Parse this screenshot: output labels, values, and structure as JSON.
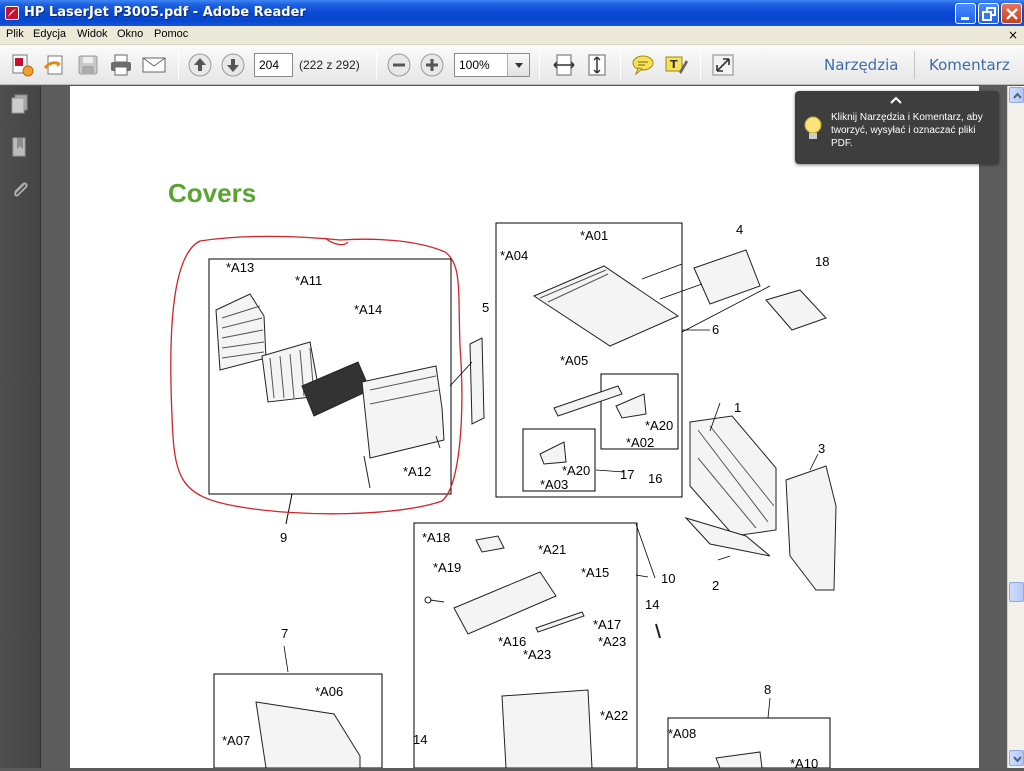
{
  "window": {
    "title": "HP LaserJet P3005.pdf - Adobe Reader"
  },
  "menu": {
    "items": [
      "Plik",
      "Edycja",
      "Widok",
      "Okno",
      "Pomoc"
    ],
    "close_glyph": "×"
  },
  "toolbar": {
    "page_number": "204",
    "page_count": "(222 z 292)",
    "zoom": "100%",
    "tools_label": "Narzędzia",
    "comment_label": "Komentarz"
  },
  "tooltip": {
    "text": "Kliknij Narzędzia i Komentarz, aby tworzyć, wysyłać i oznaczać pliki PDF."
  },
  "document": {
    "heading": "Covers",
    "heading_color": "#5aa432",
    "labels": {
      "a13": "*A13",
      "a11": "*A11",
      "a14": "*A14",
      "a12": "*A12",
      "n9": "9",
      "n5": "5",
      "a01": "*A01",
      "a04": "*A04",
      "a05": "*A05",
      "a02": "*A02",
      "a20a": "*A20",
      "a20b": "*A20",
      "a03": "*A03",
      "n17": "17",
      "n16": "16",
      "n6": "6",
      "n4": "4",
      "n18": "18",
      "n1": "1",
      "n3": "3",
      "n2": "2",
      "a18": "*A18",
      "a21": "*A21",
      "a19": "*A19",
      "a15": "*A15",
      "n10": "10",
      "n14a": "14",
      "a16": "*A16",
      "a17": "*A17",
      "a23a": "*A23",
      "a23b": "*A23",
      "a22": "*A22",
      "n7": "7",
      "a06": "*A06",
      "a07": "*A07",
      "n14b": "14",
      "n8": "8",
      "a08": "*A08",
      "a10": "*A10"
    }
  },
  "icons": {
    "app": "adobe-reader-icon",
    "create": "create-pdf-icon",
    "share": "share-icon",
    "save": "save-icon",
    "print": "print-icon",
    "email": "email-icon",
    "prev": "previous-page-icon",
    "next": "next-page-icon",
    "zoom_out": "zoom-out-icon",
    "zoom_in": "zoom-in-icon",
    "fit_width": "fit-width-icon",
    "fit_page": "fit-page-icon",
    "comment": "sticky-note-icon",
    "highlight": "highlight-text-icon",
    "fullscreen": "full-screen-icon",
    "nav_pages": "page-thumbnails-icon",
    "nav_bookmarks": "bookmarks-icon",
    "nav_attach": "attachments-icon"
  },
  "colors": {
    "annotation_circle": "#d0232a",
    "title_bar": "#0a48d2"
  }
}
